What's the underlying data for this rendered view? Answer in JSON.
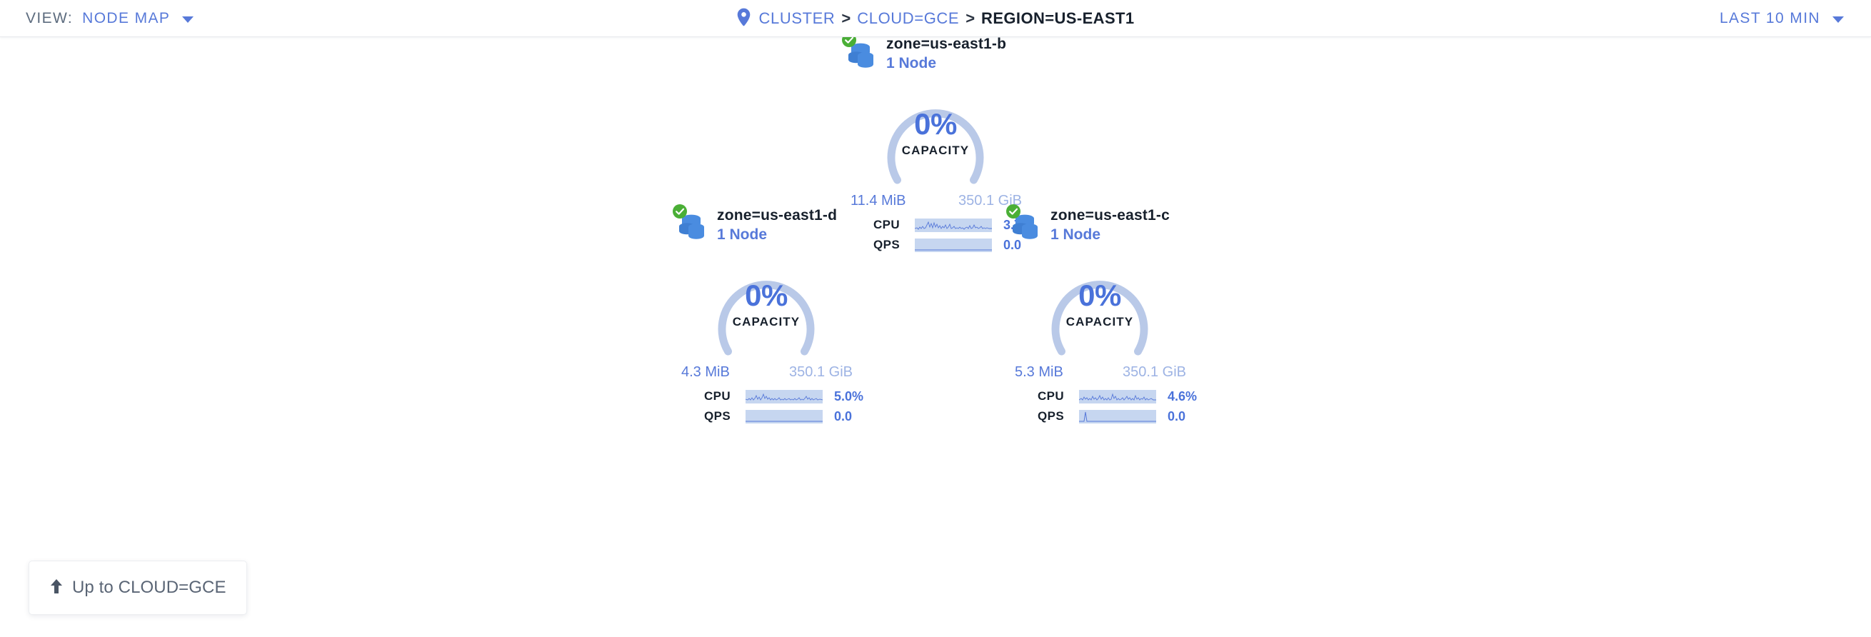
{
  "header": {
    "view_label": "VIEW:",
    "view_value": "NODE MAP",
    "view_caret_icon": "chevron-down-icon",
    "location_icon": "map-pin-icon",
    "breadcrumb": [
      {
        "label": "CLUSTER",
        "current": false
      },
      {
        "label": "CLOUD=GCE",
        "current": false
      },
      {
        "label": "REGION=US-EAST1",
        "current": true
      }
    ],
    "breadcrumb_separator": ">",
    "time_range": "LAST 10 MIN",
    "time_range_caret_icon": "chevron-down-icon"
  },
  "colors": {
    "accent_blue": "#5779d9",
    "gauge_track": "#b9c9e8",
    "spark_background": "#c6d6f0",
    "spark_line": "#5779d9",
    "status_ok_green": "#4aaf36",
    "node_icon_blue": "#4a8ce0",
    "text_dark": "#17202c",
    "muted_blue": "#9db3e4"
  },
  "nodes": [
    {
      "id": "zone-us-east1-b",
      "status_icon": "check-circle-icon",
      "node_icon": "database-cluster-icon",
      "title": "zone=us-east1-b",
      "count": "1 Node",
      "capacity_percent": "0%",
      "capacity_label": "CAPACITY",
      "capacity_value": 0,
      "used": "11.4 MiB",
      "total": "350.1 GiB",
      "metrics": [
        {
          "label": "CPU",
          "value": "3.7%",
          "sparkline": "noisy"
        },
        {
          "label": "QPS",
          "value": "0.0",
          "sparkline": "flat"
        }
      ]
    },
    {
      "id": "zone-us-east1-d",
      "status_icon": "check-circle-icon",
      "node_icon": "database-cluster-icon",
      "title": "zone=us-east1-d",
      "count": "1 Node",
      "capacity_percent": "0%",
      "capacity_label": "CAPACITY",
      "capacity_value": 0,
      "used": "4.3 MiB",
      "total": "350.1 GiB",
      "metrics": [
        {
          "label": "CPU",
          "value": "5.0%",
          "sparkline": "noisy"
        },
        {
          "label": "QPS",
          "value": "0.0",
          "sparkline": "flat"
        }
      ]
    },
    {
      "id": "zone-us-east1-c",
      "status_icon": "check-circle-icon",
      "node_icon": "database-cluster-icon",
      "title": "zone=us-east1-c",
      "count": "1 Node",
      "capacity_percent": "0%",
      "capacity_label": "CAPACITY",
      "capacity_value": 0,
      "used": "5.3 MiB",
      "total": "350.1 GiB",
      "metrics": [
        {
          "label": "CPU",
          "value": "4.6%",
          "sparkline": "noisy"
        },
        {
          "label": "QPS",
          "value": "0.0",
          "sparkline": "spike"
        }
      ]
    }
  ],
  "up_button": {
    "arrow_icon": "arrow-up-icon",
    "label": "Up to CLOUD=GCE"
  }
}
